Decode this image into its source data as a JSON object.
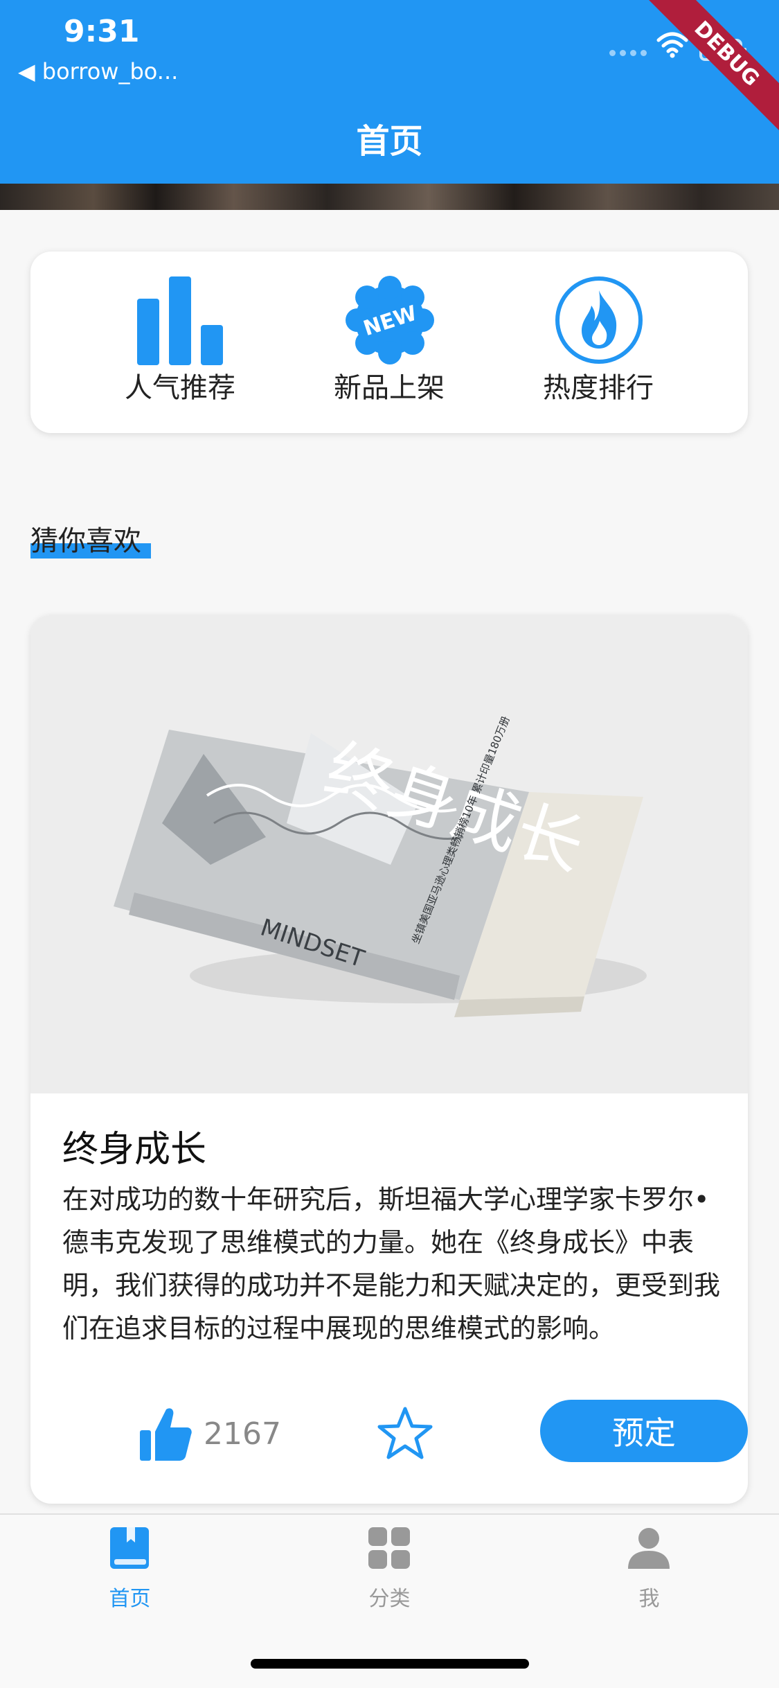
{
  "status_bar": {
    "time": "9:31",
    "back_label": "◀ borrow_bo..."
  },
  "debug_banner": "DEBUG",
  "appbar": {
    "title": "首页"
  },
  "quick_actions": [
    {
      "label": "人气推荐",
      "icon": "bar-chart-icon"
    },
    {
      "label": "新品上架",
      "icon": "new-badge-icon",
      "badge_text": "NEW"
    },
    {
      "label": "热度排行",
      "icon": "fire-icon"
    }
  ],
  "section_title": "猜你喜欢",
  "book": {
    "title": "终身成长",
    "description": "在对成功的数十年研究后，斯坦福大学心理学家卡罗尔•德韦克发现了思维模式的力量。她在《终身成长》中表明，我们获得的成功并不是能力和天赋决定的，更受到我们在追求目标的过程中展现的思维模式的影响。",
    "like_count": "2167",
    "reserve_label": "预定",
    "cover": {
      "title_text": "终身成长",
      "english_text": "MINDSET",
      "tagline": "坐镇美国亚马逊心理类畅销榜10年 累计印量180万册"
    }
  },
  "tabs": [
    {
      "label": "首页",
      "icon": "book-icon",
      "active": true
    },
    {
      "label": "分类",
      "icon": "grid-icon",
      "active": false
    },
    {
      "label": "我",
      "icon": "person-icon",
      "active": false
    }
  ],
  "colors": {
    "primary": "#2196f3",
    "debug": "#b01e3c",
    "inactive": "#999999"
  }
}
